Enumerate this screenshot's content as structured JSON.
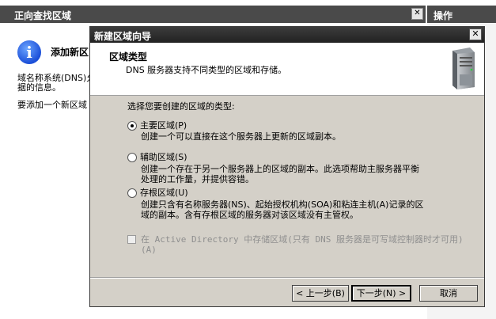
{
  "background_window": {
    "header_title": "正向查找区域",
    "close_glyph": "✕",
    "info_title": "添加新区",
    "text_lines": [
      "域名称系统(DNS)允",
      "据的信息。",
      "要添加一个新区域"
    ]
  },
  "ops_panel": {
    "title": "操作"
  },
  "dialog": {
    "title": "新建区域向导",
    "close_glyph": "✕",
    "header_title": "区域类型",
    "header_subtitle": "DNS 服务器支持不同类型的区域和存储。",
    "prompt": "选择您要创建的区域的类型:",
    "options": [
      {
        "label": "主要区域(P)",
        "selected": true,
        "description": [
          "创建一个可以直接在这个服务器上更新的区域副本。"
        ]
      },
      {
        "label": "辅助区域(S)",
        "selected": false,
        "description": [
          "创建一个存在于另一个服务器上的区域的副本。此选项帮助主服务器平衡",
          "处理的工作量，并提供容错。"
        ]
      },
      {
        "label": "存根区域(U)",
        "selected": false,
        "description": [
          "创建只含有名称服务器(NS)、起始授权机构(SOA)和粘连主机(A)记录的区",
          "域的副本。含有存根区域的服务器对该区域没有主管权。"
        ]
      }
    ],
    "ad_checkbox": {
      "checked": false,
      "disabled": true,
      "label_lines": [
        "在 Active Directory 中存储区域(只有 DNS 服务器是可写域控制器时才可用)",
        "(A)"
      ]
    },
    "buttons": {
      "back": "< 上一步(B)",
      "next": "下一步(N) >",
      "cancel": "取消"
    }
  }
}
